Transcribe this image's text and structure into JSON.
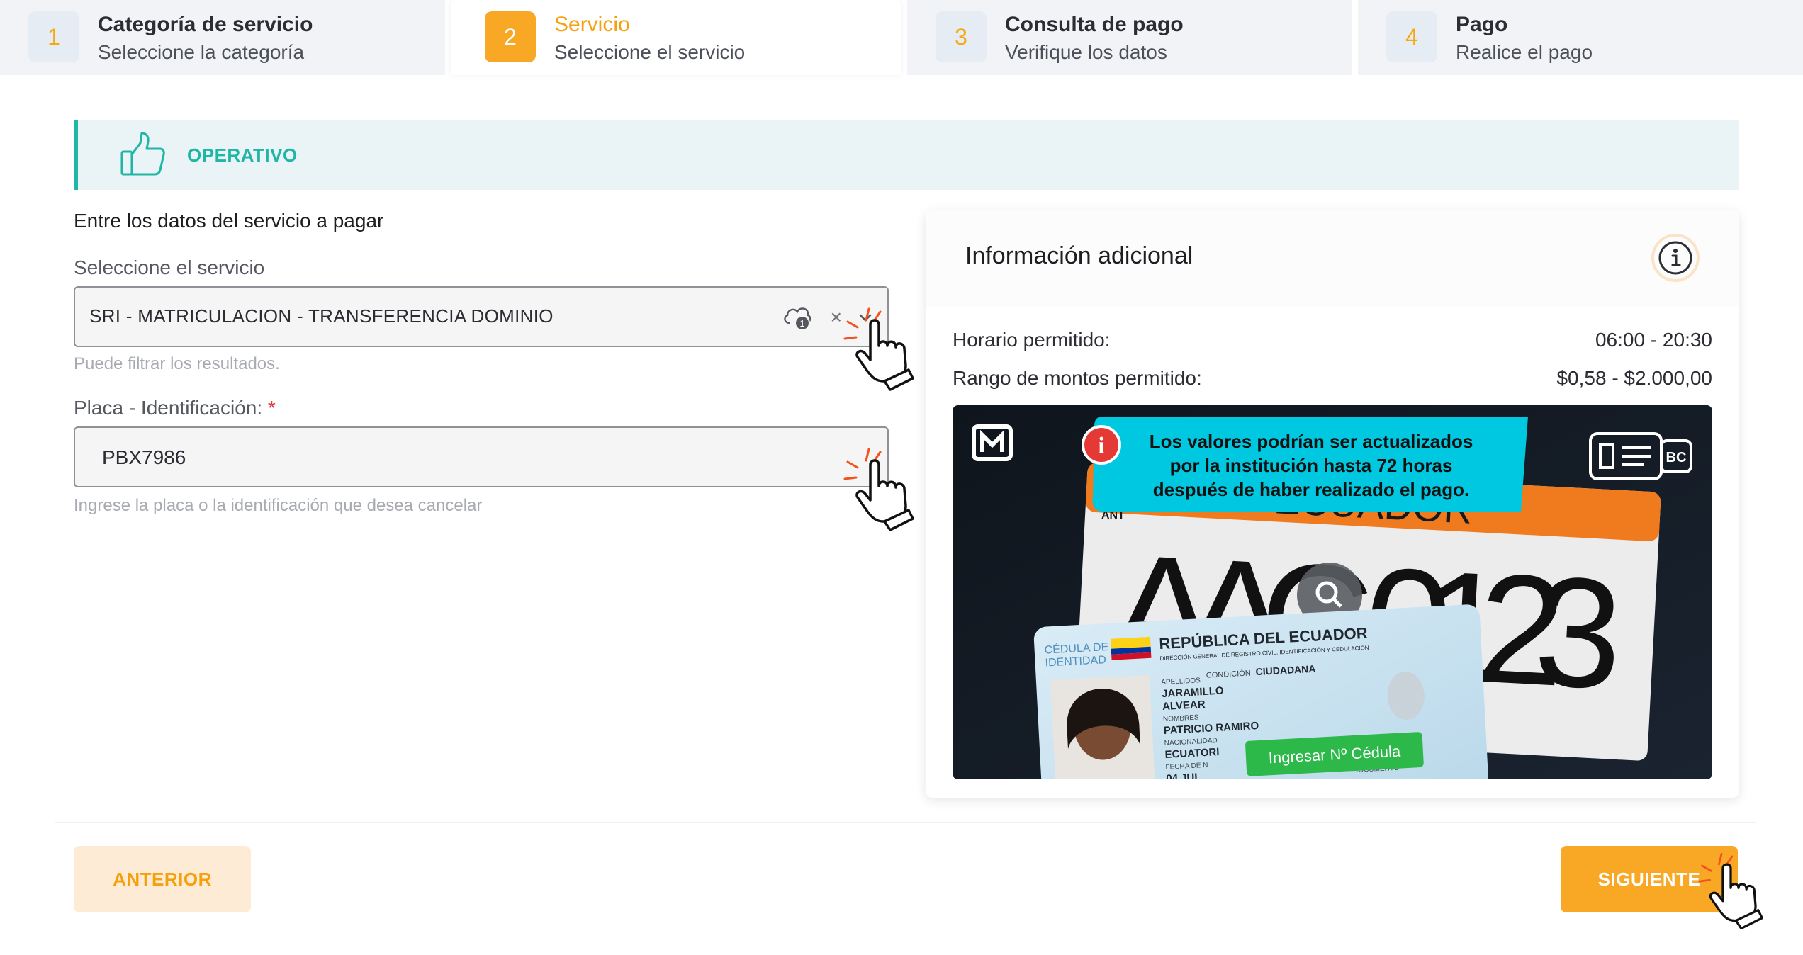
{
  "stepper": {
    "steps": [
      {
        "number": "1",
        "title": "Categoría de servicio",
        "subtitle": "Seleccione la categoría",
        "state": "done"
      },
      {
        "number": "2",
        "title": "Servicio",
        "subtitle": "Seleccione el servicio",
        "state": "active"
      },
      {
        "number": "3",
        "title": "Consulta de pago",
        "subtitle": "Verifique los datos",
        "state": "pending"
      },
      {
        "number": "4",
        "title": "Pago",
        "subtitle": "Realice el pago",
        "state": "pending"
      }
    ]
  },
  "status": {
    "label": "OPERATIVO",
    "icon": "thumbs-up-icon",
    "color": "#1fb6a6"
  },
  "form": {
    "heading": "Entre los datos del servicio a pagar",
    "service": {
      "label": "Seleccione el servicio",
      "value": "SRI - MATRICULACION - TRANSFERENCIA DOMINIO",
      "hint": "Puede filtrar los resultados.",
      "badge_count": "1",
      "clear_glyph": "×"
    },
    "plate": {
      "label": "Placa - Identificación:",
      "required_mark": "*",
      "value": "PBX7986",
      "hint": "Ingrese la placa o la identificación que desea cancelar"
    }
  },
  "info_card": {
    "title": "Información adicional",
    "rows": [
      {
        "label": "Horario permitido:",
        "value": "06:00 - 20:30"
      },
      {
        "label": "Rango de montos permitido:",
        "value": "$0,58 - $2.000,00"
      }
    ],
    "promo": {
      "notice": [
        "Los valores podrían ser actualizados",
        "por la institución hasta 72 horas",
        "después de haber realizado el pago."
      ],
      "plate_country": "ECUADOR",
      "plate_number": "AAC-0123",
      "ant": "ANT",
      "id_header": "REPÚBLICA DEL ECUADOR",
      "id_subheader": "DIRECCIÓN GENERAL DE REGISTRO CIVIL, IDENTIFICACIÓN Y CEDULACIÓN",
      "id_doc_type": [
        "CÉDULA DE",
        "IDENTIDAD"
      ],
      "id_condition_label": "CONDICIÓN",
      "id_condition": "CIUDADANA",
      "id_surnames_label": "APELLIDOS",
      "id_surnames": [
        "JARAMILLO",
        "ALVEAR"
      ],
      "id_names_label": "NOMBRES",
      "id_names": "PATRICIO RAMIRO",
      "id_nationality_label": "NACIONALIDAD",
      "id_nationality": "ECUATORI",
      "id_birth_label": "FECHA DE N",
      "id_birth": "04 JUL",
      "id_doc_label": "DOCUMENTO",
      "cta": "Ingresar Nº Cédula",
      "tag": "BC"
    }
  },
  "footer": {
    "prev_label": "ANTERIOR",
    "next_label": "SIGUIENTE"
  },
  "colors": {
    "accent": "#f9a825",
    "operativo": "#1fb6a6",
    "promo_notice": "#00c8e0",
    "cta": "#2db84a"
  }
}
